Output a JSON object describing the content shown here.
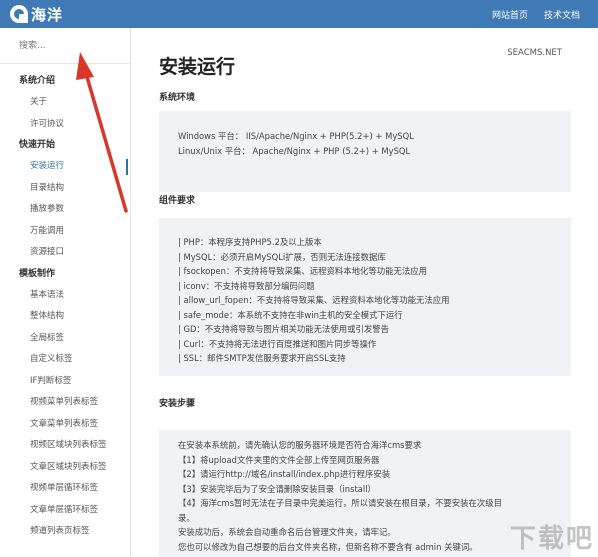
{
  "header": {
    "logo_text": "海洋",
    "nav": [
      "网站首页",
      "技术文档"
    ]
  },
  "sidebar": {
    "search_placeholder": "搜索...",
    "groups": [
      {
        "title": "系统介绍",
        "items": [
          "关于",
          "许可协议"
        ]
      },
      {
        "title": "快速开始",
        "items": [
          "安装运行",
          "目录结构",
          "播放参数",
          "万能调用",
          "资源接口"
        ]
      },
      {
        "title": "模板制作",
        "items": [
          "基本语法",
          "整体结构",
          "全局标签",
          "自定义标签",
          "IF判断标签",
          "视频菜单列表标签",
          "文章菜单列表标签",
          "视频区域块列表标签",
          "文章区域块列表标签",
          "视频单层循环标签",
          "文章单层循环标签",
          "频道列表页标签"
        ]
      }
    ],
    "active_item": "安装运行"
  },
  "main": {
    "site_tag": "SEACMS.NET",
    "title": "安装运行",
    "sections": [
      {
        "heading": "系统环境",
        "lines": [
          "Windows 平台： IIS/Apache/Nginx + PHP(5.2+) + MySQL",
          "Linux/Unix 平台： Apache/Nginx + PHP (5.2+) + MySQL"
        ]
      },
      {
        "heading": "组件要求",
        "lines": [
          "| PHP：本程序支持PHP5.2及以上版本",
          "| MySQL：必须开启MySQLi扩展，否则无法连接数据库",
          "| fsockopen：不支持将导致采集、远程资料本地化等功能无法应用",
          "| iconv：不支持将导致部分编码问题",
          "| allow_url_fopen：不支持将导致采集、远程资料本地化等功能无法应用",
          "| safe_mode：本系统不支持在非win主机的安全模式下运行",
          "| GD：不支持将导致与图片相关功能无法使用或引发警告",
          "| Curl：不支持将无法进行百度推送和图片同步等操作",
          "| SSL：邮件SMTP发信服务要求开启SSL支持"
        ]
      },
      {
        "heading": "安装步骤",
        "lines": [
          "在安装本系统前，请先确认您的服务器环境是否符合海洋cms要求",
          "【1】将upload文件夹里的文件全部上传至网页服务器",
          "【2】请运行http://域名/install/index.php进行程序安装",
          "【3】安装完毕后为了安全请删除安装目录（install）",
          "【4】海洋cms暂时无法在子目录中完美运行，所以请安装在根目录，不要安装在次级目",
          "录。",
          "安装成功后，系统会自动重命名后台管理文件夹，请牢记。",
          "您也可以修改为自己想要的后台文件夹名称，但新名称不要含有 admin 关键词。"
        ]
      }
    ]
  },
  "overlay": {
    "watermark_text": "下载吧",
    "arrow_color": "#d9372b"
  }
}
